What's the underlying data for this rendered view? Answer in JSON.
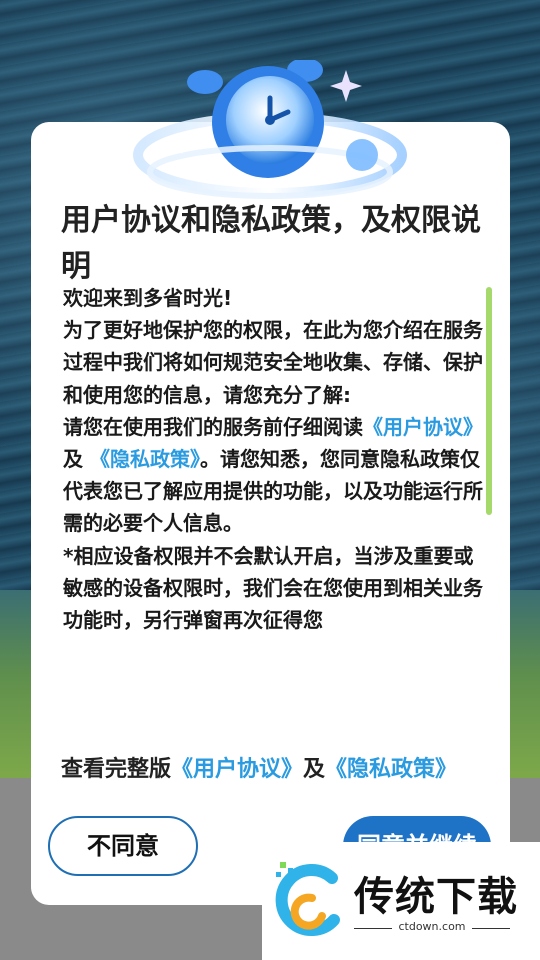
{
  "dialog": {
    "title": "用户协议和隐私政策，及权限说明",
    "body": {
      "greeting": "欢迎来到多省时光!",
      "intro": "为了更好地保护您的权限，在此为您介绍在服务过程中我们将如何规范安全地收集、存储、保护和使用您的信息，请您充分了解:",
      "read_prefix": "请您在使用我们的服务前仔细阅读",
      "user_agreement": "《用户协议》",
      "and": "及",
      "privacy_policy": "《隐私政策》",
      "read_suffix": "。请您知悉，您同意隐私政策仅代表您已了解应用提供的功能，以及功能运行所需的必要个人信息。",
      "permission_note": "*相应设备权限并不会默认开启，当涉及重要或敏感的设备权限时，我们会在您使用到相关业务功能时，另行弹窗再次征得您"
    },
    "links_line": {
      "prefix": "查看完整版",
      "user_agreement": "《用户协议》",
      "and": "及",
      "privacy_policy": "《隐私政策》"
    },
    "buttons": {
      "disagree": "不同意",
      "agree": "同意并继续"
    }
  },
  "watermark": {
    "name": "传统下载",
    "url": "ctdown.com"
  },
  "colors": {
    "link": "#2a9be0",
    "primary_button": "#1f73c7",
    "scrollbar": "#a6d96b"
  },
  "icons": [
    "alarm-clock-icon",
    "sparkle-icon",
    "ctdown-logo-icon"
  ]
}
